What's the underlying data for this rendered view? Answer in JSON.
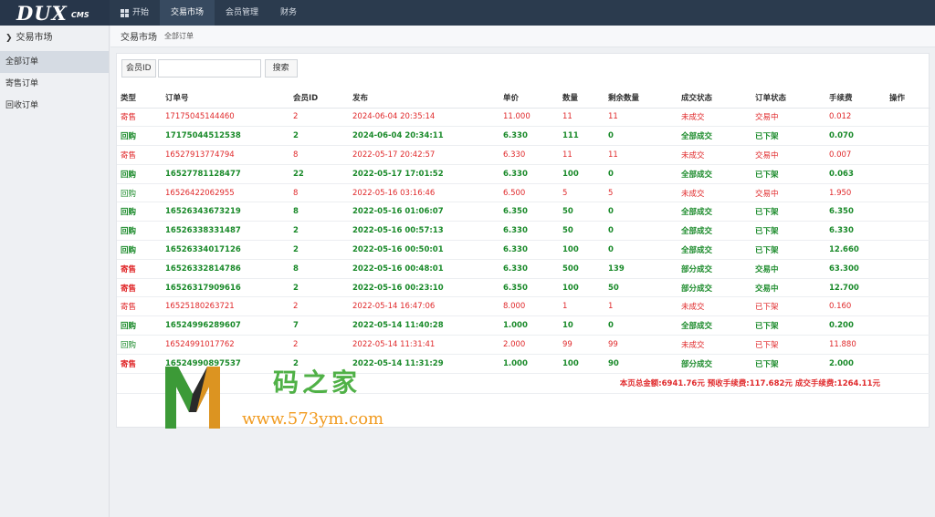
{
  "logo": {
    "main": "DUX",
    "sub": "CMS"
  },
  "nav": [
    {
      "label": "开始",
      "active": false,
      "icon": "windows-icon"
    },
    {
      "label": "交易市场",
      "active": true
    },
    {
      "label": "会员管理",
      "active": false
    },
    {
      "label": "财务",
      "active": false
    }
  ],
  "sidebar": {
    "heading": "交易市场",
    "items": [
      {
        "label": "全部订单",
        "active": true
      },
      {
        "label": "寄售订单",
        "active": false
      },
      {
        "label": "回收订单",
        "active": false
      }
    ]
  },
  "breadcrumb": {
    "title": "交易市场",
    "sub": "全部订单"
  },
  "search": {
    "label": "会员ID",
    "value": "",
    "button": "搜索"
  },
  "table": {
    "headers": [
      "类型",
      "订单号",
      "会员ID",
      "发布",
      "单价",
      "数量",
      "剩余数量",
      "成交状态",
      "订单状态",
      "手续费",
      "操作"
    ],
    "rows": [
      {
        "type": "寄售",
        "order_no": "17175045144460",
        "member_id": "2",
        "published": "2024-06-04 20:35:14",
        "price": "11.000",
        "qty": "11",
        "remaining": "11",
        "deal_status": "未成交",
        "order_status": "交易中",
        "fee": "0.012",
        "color": "red",
        "bold": false
      },
      {
        "type": "回购",
        "order_no": "17175044512538",
        "member_id": "2",
        "published": "2024-06-04 20:34:11",
        "price": "6.330",
        "qty": "111",
        "remaining": "0",
        "deal_status": "全部成交",
        "order_status": "已下架",
        "fee": "0.070",
        "color": "green",
        "bold": true
      },
      {
        "type": "寄售",
        "order_no": "16527913774794",
        "member_id": "8",
        "published": "2022-05-17 20:42:57",
        "price": "6.330",
        "qty": "11",
        "remaining": "11",
        "deal_status": "未成交",
        "order_status": "交易中",
        "fee": "0.007",
        "color": "red",
        "bold": false
      },
      {
        "type": "回购",
        "order_no": "16527781128477",
        "member_id": "22",
        "published": "2022-05-17 17:01:52",
        "price": "6.330",
        "qty": "100",
        "remaining": "0",
        "deal_status": "全部成交",
        "order_status": "已下架",
        "fee": "0.063",
        "color": "green",
        "bold": true
      },
      {
        "type": "回购",
        "order_no": "16526422062955",
        "member_id": "8",
        "published": "2022-05-16 03:16:46",
        "price": "6.500",
        "qty": "5",
        "remaining": "5",
        "deal_status": "未成交",
        "order_status": "交易中",
        "fee": "1.950",
        "color": "mixed",
        "bold": false
      },
      {
        "type": "回购",
        "order_no": "16526343673219",
        "member_id": "8",
        "published": "2022-05-16 01:06:07",
        "price": "6.350",
        "qty": "50",
        "remaining": "0",
        "deal_status": "全部成交",
        "order_status": "已下架",
        "fee": "6.350",
        "color": "green",
        "bold": true
      },
      {
        "type": "回购",
        "order_no": "16526338331487",
        "member_id": "2",
        "published": "2022-05-16 00:57:13",
        "price": "6.330",
        "qty": "50",
        "remaining": "0",
        "deal_status": "全部成交",
        "order_status": "已下架",
        "fee": "6.330",
        "color": "green",
        "bold": true
      },
      {
        "type": "回购",
        "order_no": "16526334017126",
        "member_id": "2",
        "published": "2022-05-16 00:50:01",
        "price": "6.330",
        "qty": "100",
        "remaining": "0",
        "deal_status": "全部成交",
        "order_status": "已下架",
        "fee": "12.660",
        "color": "green",
        "bold": true
      },
      {
        "type": "寄售",
        "order_no": "16526332814786",
        "member_id": "8",
        "published": "2022-05-16 00:48:01",
        "price": "6.330",
        "qty": "500",
        "remaining": "139",
        "deal_status": "部分成交",
        "order_status": "交易中",
        "fee": "63.300",
        "color": "mixed2",
        "bold": true
      },
      {
        "type": "寄售",
        "order_no": "16526317909616",
        "member_id": "2",
        "published": "2022-05-16 00:23:10",
        "price": "6.350",
        "qty": "100",
        "remaining": "50",
        "deal_status": "部分成交",
        "order_status": "交易中",
        "fee": "12.700",
        "color": "mixed2",
        "bold": true
      },
      {
        "type": "寄售",
        "order_no": "16525180263721",
        "member_id": "2",
        "published": "2022-05-14 16:47:06",
        "price": "8.000",
        "qty": "1",
        "remaining": "1",
        "deal_status": "未成交",
        "order_status": "已下架",
        "fee": "0.160",
        "color": "red",
        "bold": false
      },
      {
        "type": "回购",
        "order_no": "16524996289607",
        "member_id": "7",
        "published": "2022-05-14 11:40:28",
        "price": "1.000",
        "qty": "10",
        "remaining": "0",
        "deal_status": "全部成交",
        "order_status": "已下架",
        "fee": "0.200",
        "color": "green",
        "bold": true
      },
      {
        "type": "回购",
        "order_no": "16524991017762",
        "member_id": "2",
        "published": "2022-05-14 11:31:41",
        "price": "2.000",
        "qty": "99",
        "remaining": "99",
        "deal_status": "未成交",
        "order_status": "已下架",
        "fee": "11.880",
        "color": "mixed",
        "bold": false
      },
      {
        "type": "寄售",
        "order_no": "16524990897537",
        "member_id": "2",
        "published": "2022-05-14 11:31:29",
        "price": "1.000",
        "qty": "100",
        "remaining": "90",
        "deal_status": "部分成交",
        "order_status": "已下架",
        "fee": "2.000",
        "color": "mixed2",
        "bold": true
      }
    ],
    "summary": "本页总金额:6941.76元  预收手续费:117.682元  成交手续费:1264.11元"
  },
  "watermark": {
    "chinese": "码之家",
    "url": "www.573ym.com"
  },
  "colors": {
    "red": "#e0292b",
    "green": "#1a8a2a",
    "topbar": "#2b3b4e"
  }
}
